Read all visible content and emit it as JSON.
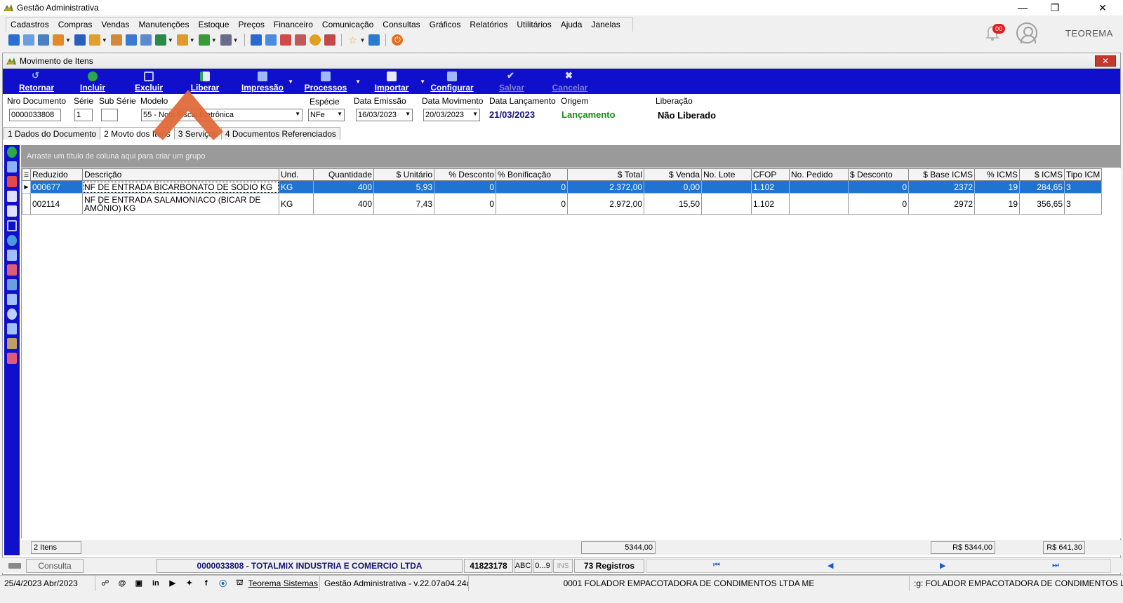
{
  "window": {
    "title": "Gestão Administrativa"
  },
  "menu": [
    "Cadastros",
    "Compras",
    "Vendas",
    "Manutenções",
    "Estoque",
    "Preços",
    "Financeiro",
    "Comunicação",
    "Consultas",
    "Gráficos",
    "Relatórios",
    "Utilitários",
    "Ajuda",
    "Janelas"
  ],
  "topright": {
    "badge": "00",
    "user": "TEOREMA"
  },
  "child": {
    "title": "Movimento de Itens",
    "actions": [
      {
        "label": "Retornar",
        "enabled": true
      },
      {
        "label": "Incluir",
        "enabled": true
      },
      {
        "label": "Excluir",
        "enabled": true
      },
      {
        "label": "Liberar",
        "enabled": true
      },
      {
        "label": "Impressão",
        "enabled": true
      },
      {
        "label": "Processos",
        "enabled": true
      },
      {
        "label": "Importar",
        "enabled": true
      },
      {
        "label": "Configurar",
        "enabled": true
      },
      {
        "label": "Salvar",
        "enabled": false
      },
      {
        "label": "Cancelar",
        "enabled": false
      }
    ]
  },
  "fields": {
    "nro_documento_label": "Nro Documento",
    "nro_documento": "0000033808",
    "serie_label": "Série",
    "serie": "1",
    "sub_serie_label": "Sub Série",
    "sub_serie": "",
    "modelo_label": "Modelo",
    "modelo": "55 - Nota Fiscal Eletrônica",
    "especie_label": "Espécie",
    "especie": "NFe",
    "data_emissao_label": "Data Emissão",
    "data_emissao": "16/03/2023",
    "data_movimento_label": "Data Movimento",
    "data_movimento": "20/03/2023",
    "data_lancamento_label": "Data Lançamento",
    "data_lancamento": "21/03/2023",
    "origem_label": "Origem",
    "origem": "Lançamento",
    "liberacao_label": "Liberação",
    "liberacao": "Não Liberado"
  },
  "tabs": [
    "1 Dados do Documento",
    "2 Movto dos Itens",
    "3 Serviços",
    "4 Documentos Referenciados"
  ],
  "grid": {
    "group_hint": "Arraste um título de coluna aqui para criar um grupo",
    "columns": [
      "Reduzido",
      "Descrição",
      "Und.",
      "Quantidade",
      "$ Unitário",
      "% Desconto",
      "% Bonificação",
      "$ Total",
      "$ Venda",
      "No. Lote",
      "CFOP",
      "No. Pedido",
      "$ Desconto",
      "$ Base ICMS",
      "% ICMS",
      "$ ICMS",
      "Tipo ICM"
    ],
    "rows": [
      [
        "000677",
        "NF DE ENTRADA BICARBONATO DE SODIO KG",
        "KG",
        "400",
        "5,93",
        "0",
        "0",
        "2.372,00",
        "0,00",
        "",
        "1.102",
        "",
        "0",
        "2372",
        "19",
        "284,65",
        "3"
      ],
      [
        "002114",
        "NF DE ENTRADA SALAMONIACO (BICAR DE AMÔNIO) KG",
        "KG",
        "400",
        "7,43",
        "0",
        "0",
        "2.972,00",
        "15,50",
        "",
        "1.102",
        "",
        "0",
        "2972",
        "19",
        "356,65",
        "3"
      ]
    ]
  },
  "totals": {
    "count": "2 Itens",
    "total": "5344,00",
    "base_icms": "R$ 5344,00",
    "icms": "R$ 641,30"
  },
  "nav": {
    "mode": "Consulta",
    "company": "0000033808 - TOTALMIX INDUSTRIA E COMERCIO LTDA",
    "code": "41823178",
    "abc": "ABC",
    "num": "0...9",
    "ins": "INS",
    "records": "73 Registros"
  },
  "status": {
    "date": "25/4/2023 Abr/2023",
    "vendor": "Teorema Sistemas",
    "version": "Gestão Administrativa - v.22.07a04.24a",
    "company": "0001 FOLADOR EMPACOTADORA DE CONDIMENTOS LTDA ME",
    "company2": ":g: FOLADOR EMPACOTADORA DE CONDIMENTOS LTD"
  }
}
